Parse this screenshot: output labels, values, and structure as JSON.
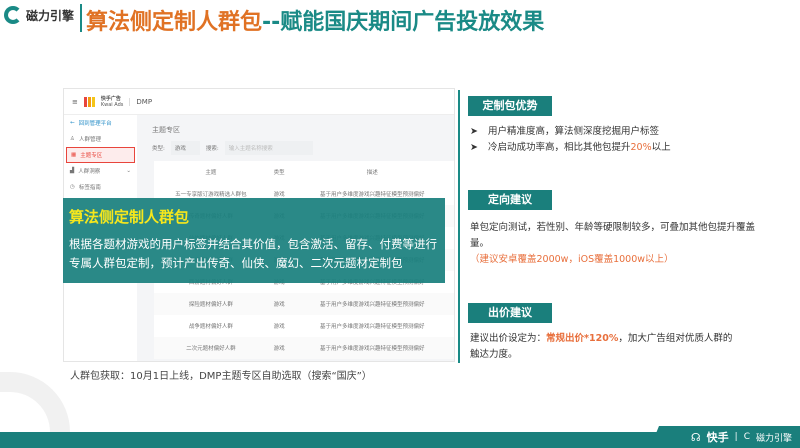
{
  "brand": "磁力引擎",
  "title": {
    "part1": "算法侧定制人群包",
    "part2": "--赋能国庆期间广告投放效果"
  },
  "screenshot": {
    "header": {
      "logo_cn": "快手广告",
      "logo_en": "Kwai Ads",
      "product": "DMP"
    },
    "sidebar": [
      "回到管理平台",
      "人群管理",
      "主题专区",
      "人群洞察",
      "标签指南"
    ],
    "main": {
      "heading": "主题专区",
      "filter_label": "类型:",
      "filter_value": "游戏",
      "search_label": "搜索:",
      "search_placeholder": "输入主题名称搜索",
      "columns": [
        "主题",
        "类型",
        "描述"
      ],
      "rows": [
        [
          "五一专享版订游戏精选人群包",
          "游戏",
          "基于用户多维度游戏兴趣特征模型预测偏好"
        ],
        [
          "传奇题材偏好人群",
          "游戏",
          "基于用户多维度游戏兴趣特征模型预测偏好"
        ],
        [
          "仙侠题材偏好人群",
          "游戏",
          "基于用户多维度游戏兴趣特征模型预测偏好"
        ],
        [
          "魔幻题材偏好人群",
          "游戏",
          "基于用户多维度游戏兴趣特征模型预测偏好"
        ],
        [
          "西游题材偏好人群",
          "游戏",
          "基于用户多维度游戏兴趣特征模型预测偏好"
        ],
        [
          "探险题材偏好人群",
          "游戏",
          "基于用户多维度游戏兴趣特征模型预测偏好"
        ],
        [
          "战争题材偏好人群",
          "游戏",
          "基于用户多维度游戏兴趣特征模型预测偏好"
        ],
        [
          "二次元题材偏好人群",
          "游戏",
          "基于用户多维度游戏兴趣特征模型预测偏好"
        ]
      ]
    }
  },
  "banner": {
    "title": "算法侧定制人群包",
    "text": "根据各题材游戏的用户标签并结合其价值，包含激活、留存、付费等进行专属人群包定制，预计产出传奇、仙侠、魔幻、二次元题材定制包"
  },
  "caption": "人群包获取：10月1日上线，DMP主题专区自助选取（搜索“国庆”）",
  "sections": {
    "advantage": {
      "title": "定制包优势",
      "b1": "用户精准度高，算法侧深度挖掘用户标签",
      "b2_pre": "冷启动成功率高，相比其他包提升",
      "b2_hl": "20%",
      "b2_post": "以上"
    },
    "targeting": {
      "title": "定向建议",
      "text": "单包定向测试，若性别、年龄等硬限制较多，可叠加其他包提升覆盖量。",
      "note": "（建议安卓覆盖2000w，iOS覆盖1000w以上）"
    },
    "bid": {
      "title": "出价建议",
      "pre": "建议出价设定为：",
      "hl": "常规出价*120%",
      "post": "，加大广告组对优质人群的触达力度。"
    }
  },
  "footer": {
    "kuaishou": "快手",
    "brand": "磁力引擎"
  }
}
